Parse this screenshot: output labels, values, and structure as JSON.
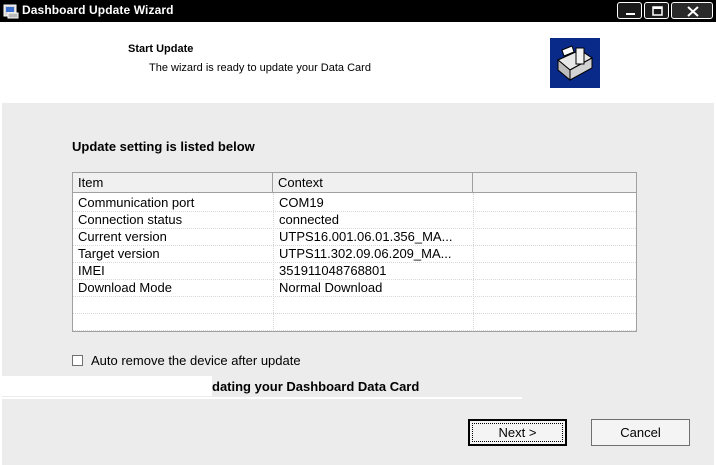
{
  "window": {
    "title": "Dashboard Update Wizard",
    "controls": [
      "minimize",
      "maximize",
      "close"
    ]
  },
  "header": {
    "title": "Start Update",
    "subtitle": "The wizard is ready to update your Data Card",
    "image_icon": "computer-setup-icon"
  },
  "main": {
    "section_label": "Update setting is listed below",
    "table": {
      "columns": [
        "Item",
        "Context",
        ""
      ],
      "rows": [
        {
          "item": "Communication port",
          "context": "COM19"
        },
        {
          "item": "Connection status",
          "context": "connected"
        },
        {
          "item": "Current version",
          "context": "UTPS16.001.06.01.356_MA..."
        },
        {
          "item": "Target version",
          "context": "UTPS11.302.09.06.209_MA..."
        },
        {
          "item": "IMEI",
          "context": "351911048768801"
        },
        {
          "item": "Download Mode",
          "context": "Normal Download"
        }
      ]
    },
    "checkbox": {
      "label": "Auto remove the device after update",
      "checked": false
    },
    "instruction_visible": "dating your Dashboard Data Card"
  },
  "buttons": {
    "next": "Next >",
    "cancel": "Cancel"
  },
  "colors": {
    "titlebar": "#000000",
    "body": "#ececec",
    "header_image": "#0a2a8a"
  }
}
